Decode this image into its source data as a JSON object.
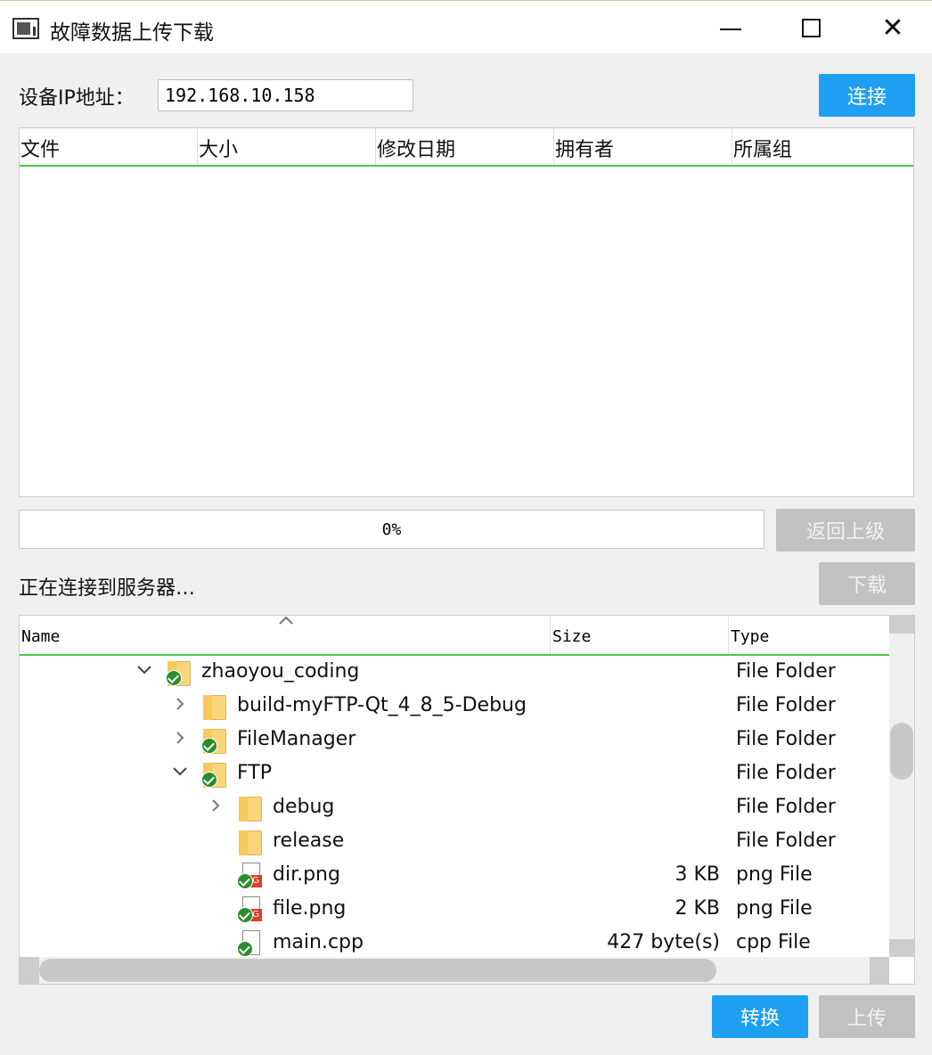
{
  "window": {
    "title": "故障数据上传下载",
    "minimize_icon": "minimize-icon",
    "maximize_icon": "maximize-icon",
    "close_glyph": "✕"
  },
  "connection": {
    "ip_label": "设备IP地址：",
    "ip_value": "192.168.10.158",
    "connect_label": "连接"
  },
  "remote_table": {
    "columns": [
      "文件",
      "大小",
      "修改日期",
      "拥有者",
      "所属组"
    ]
  },
  "progress": {
    "value": 0,
    "text": "0%"
  },
  "buttons": {
    "back_label": "返回上级",
    "download_label": "下载",
    "convert_label": "转换",
    "upload_label": "上传"
  },
  "status": {
    "text": "正在连接到服务器…"
  },
  "local_tree": {
    "columns": {
      "name": "Name",
      "size": "Size",
      "type": "Type"
    },
    "rows": [
      {
        "name": "zhaoyou_coding",
        "size": "",
        "type": "File Folder",
        "depth": 0,
        "expander": "expanded",
        "icon": "synced-folder-icon"
      },
      {
        "name": "build-myFTP-Qt_4_8_5-Debug",
        "size": "",
        "type": "File Folder",
        "depth": 1,
        "expander": "collapsed",
        "icon": "folder-icon"
      },
      {
        "name": "FileManager",
        "size": "",
        "type": "File Folder",
        "depth": 1,
        "expander": "collapsed",
        "icon": "synced-folder-icon"
      },
      {
        "name": "FTP",
        "size": "",
        "type": "File Folder",
        "depth": 1,
        "expander": "expanded",
        "icon": "synced-folder-icon"
      },
      {
        "name": "debug",
        "size": "",
        "type": "File Folder",
        "depth": 2,
        "expander": "collapsed",
        "icon": "folder-icon"
      },
      {
        "name": "release",
        "size": "",
        "type": "File Folder",
        "depth": 2,
        "expander": "none",
        "icon": "folder-icon"
      },
      {
        "name": "dir.png",
        "size": "3 KB",
        "type": "png File",
        "depth": 2,
        "expander": "none",
        "icon": "synced-image-file-icon"
      },
      {
        "name": "file.png",
        "size": "2 KB",
        "type": "png File",
        "depth": 2,
        "expander": "none",
        "icon": "synced-image-file-icon"
      },
      {
        "name": "main.cpp",
        "size": "427 byte(s)",
        "type": "cpp File",
        "depth": 2,
        "expander": "none",
        "icon": "synced-cpp-file-icon"
      }
    ]
  },
  "colors": {
    "accent_blue": "#1e9ff2",
    "disabled_gray": "#c1c1c1",
    "header_line_green": "#4cc64c"
  }
}
